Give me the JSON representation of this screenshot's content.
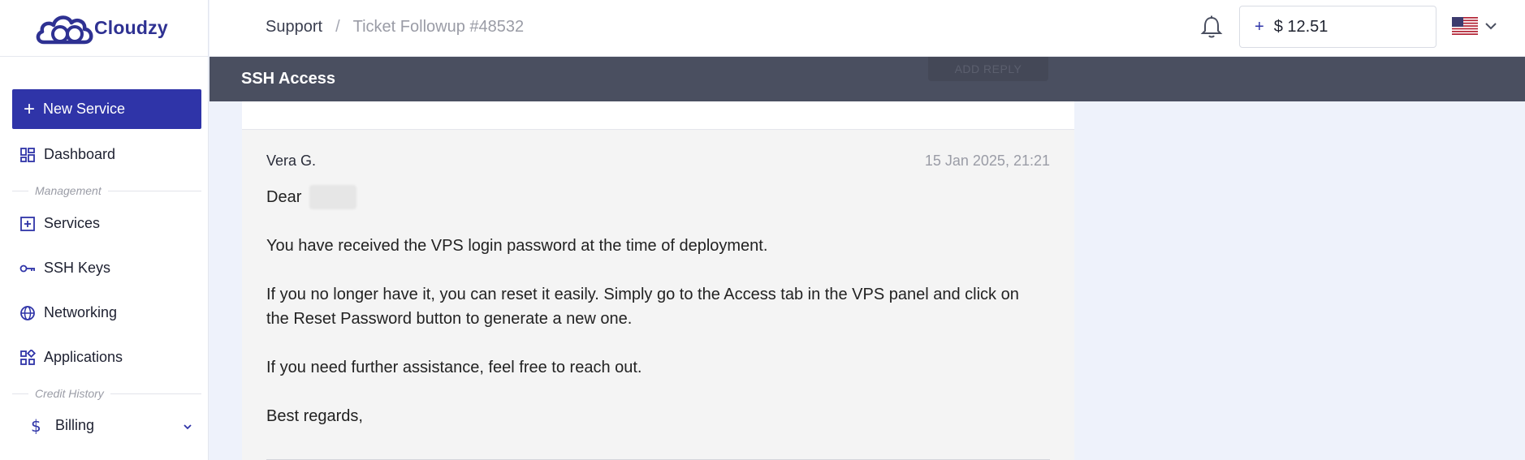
{
  "app": {
    "name": "Cloudzy",
    "brand_color": "#2f34a8"
  },
  "sidebar": {
    "new_service_label": "New Service",
    "items": [
      {
        "label": "Dashboard",
        "icon": "dashboard-icon"
      },
      {
        "label": "Services",
        "icon": "plus-square-icon"
      },
      {
        "label": "SSH Keys",
        "icon": "key-icon"
      },
      {
        "label": "Networking",
        "icon": "globe-icon"
      },
      {
        "label": "Applications",
        "icon": "apps-icon"
      },
      {
        "label": "Billing",
        "icon": "dollar-icon"
      }
    ],
    "sections": {
      "management": "Management",
      "credit_history": "Credit History"
    }
  },
  "topbar": {
    "breadcrumb": {
      "parent": "Support",
      "separator": "/",
      "current": "Ticket Followup #48532"
    },
    "balance": "$ 12.51",
    "balance_plus": "+",
    "language_flag": "us-flag-icon"
  },
  "ticket": {
    "title": "SSH Access",
    "reply_button": "ADD REPLY",
    "message": {
      "author": "Vera G.",
      "date": "15 Jan 2025, 21:21",
      "greeting": "Dear",
      "paragraphs": [
        "You have received the VPS login password at the time of deployment.",
        "If you no longer have it, you can reset it easily. Simply go to the Access tab in the VPS panel and click on the Reset Password button to generate a new one.",
        "If you need further assistance, feel free to reach out.",
        "Best regards,"
      ]
    }
  }
}
